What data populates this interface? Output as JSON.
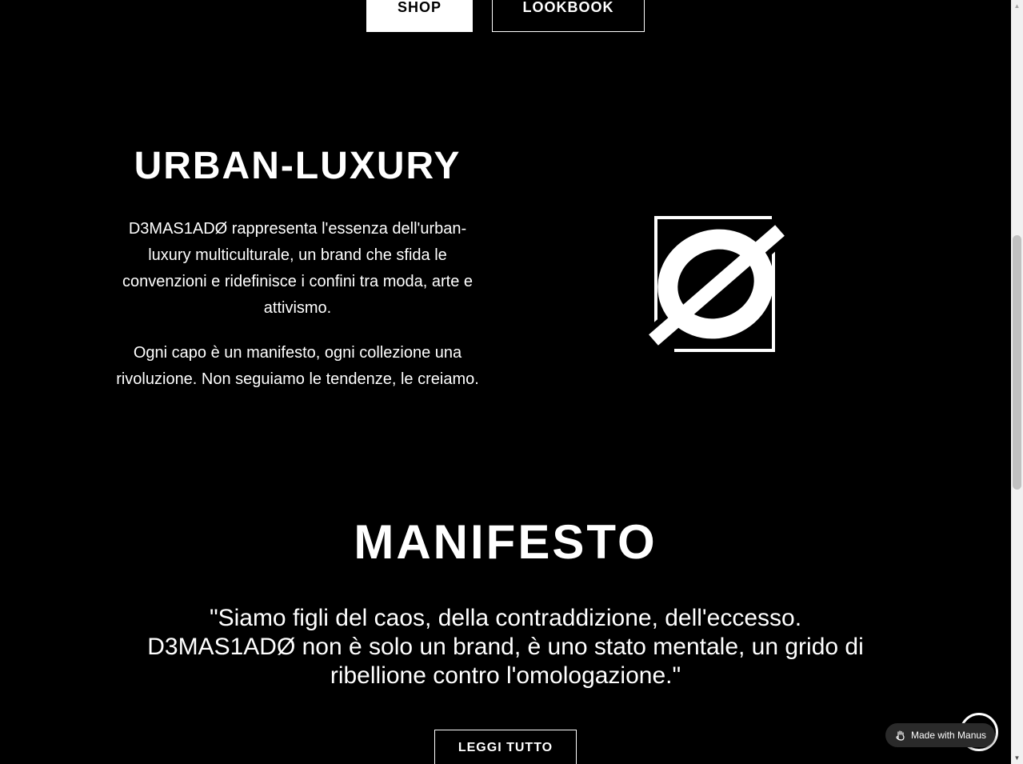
{
  "hero": {
    "shop_label": "SHOP",
    "lookbook_label": "LOOKBOOK"
  },
  "about": {
    "title": "URBAN-LUXURY",
    "paragraph_1": "D3MAS1ADØ rappresenta l'essenza dell'urban-luxury multiculturale, un brand che sfida le convenzioni e ridefinisce i confini tra moda, arte e attivismo.",
    "paragraph_2": "Ogni capo è un manifesto, ogni collezione una rivoluzione. Non seguiamo le tendenze, le creiamo.",
    "logo_icon": "slashed-o-logo-icon"
  },
  "manifesto": {
    "title": "MANIFESTO",
    "quote": "\"Siamo figli del caos, della contraddizione, dell'eccesso. D3MAS1ADØ non è solo un brand, è uno stato mentale, un grido di ribellione contro l'omologazione.\"",
    "cta_label": "LEGGI TUTTO"
  },
  "badge": {
    "label": "Made with Manus",
    "icon": "manus-hand-icon"
  },
  "colors": {
    "background": "#000000",
    "foreground": "#ffffff"
  }
}
